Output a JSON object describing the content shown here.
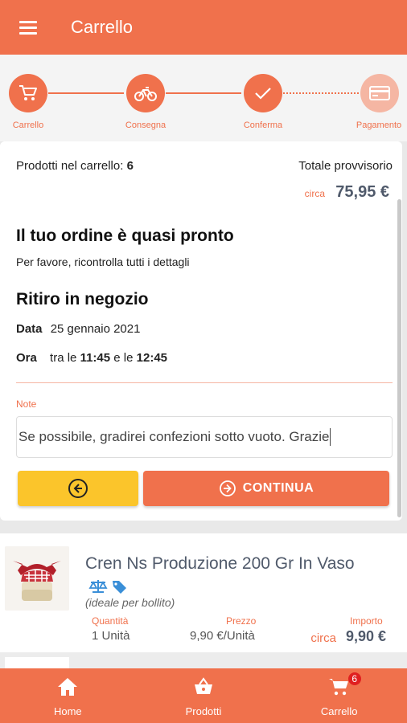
{
  "appbar": {
    "title": "Carrello"
  },
  "steps": [
    {
      "label": "Carrello",
      "icon": "cart-icon",
      "state": "done"
    },
    {
      "label": "Consegna",
      "icon": "bicycle-icon",
      "state": "done"
    },
    {
      "label": "Conferma",
      "icon": "check-icon",
      "state": "current"
    },
    {
      "label": "Pagamento",
      "icon": "credit-card-icon",
      "state": "future"
    }
  ],
  "summary": {
    "products_label": "Prodotti nel carrello:",
    "products_count": "6",
    "total_label": "Totale provvisorio",
    "circa": "circa",
    "total_value": "75,95 €"
  },
  "order": {
    "heading": "Il tuo ordine è quasi pronto",
    "subheading": "Per favore, ricontrolla tutti i dettagli"
  },
  "pickup": {
    "heading": "Ritiro in negozio",
    "date_key": "Data",
    "date_value": "25 gennaio 2021",
    "time_key": "Ora",
    "time_prefix": "tra le",
    "time_from": "11:45",
    "time_mid": "e le",
    "time_to": "12:45"
  },
  "note": {
    "label": "Note",
    "value": "Se possibile, gradirei confezioni sotto vuoto. Grazie"
  },
  "buttons": {
    "continue_label": "CONTINUA"
  },
  "product": {
    "name": "Cren Ns Produzione 200 Gr In Vaso",
    "note": "(ideale per bollito)",
    "qty_header": "Quantità",
    "qty_value": "1 Unità",
    "price_header": "Prezzo",
    "price_value": "9,90 €/Unità",
    "amount_header": "Importo",
    "amount_circa": "circa",
    "amount_value": "9,90 €"
  },
  "bottom_nav": [
    {
      "label": "Home",
      "icon": "home-icon"
    },
    {
      "label": "Prodotti",
      "icon": "basket-icon"
    },
    {
      "label": "Carrello",
      "icon": "cart-icon",
      "badge": "6"
    }
  ],
  "colors": {
    "primary": "#f0714c",
    "back_button": "#fbc52b",
    "price_text": "#505a6b"
  }
}
